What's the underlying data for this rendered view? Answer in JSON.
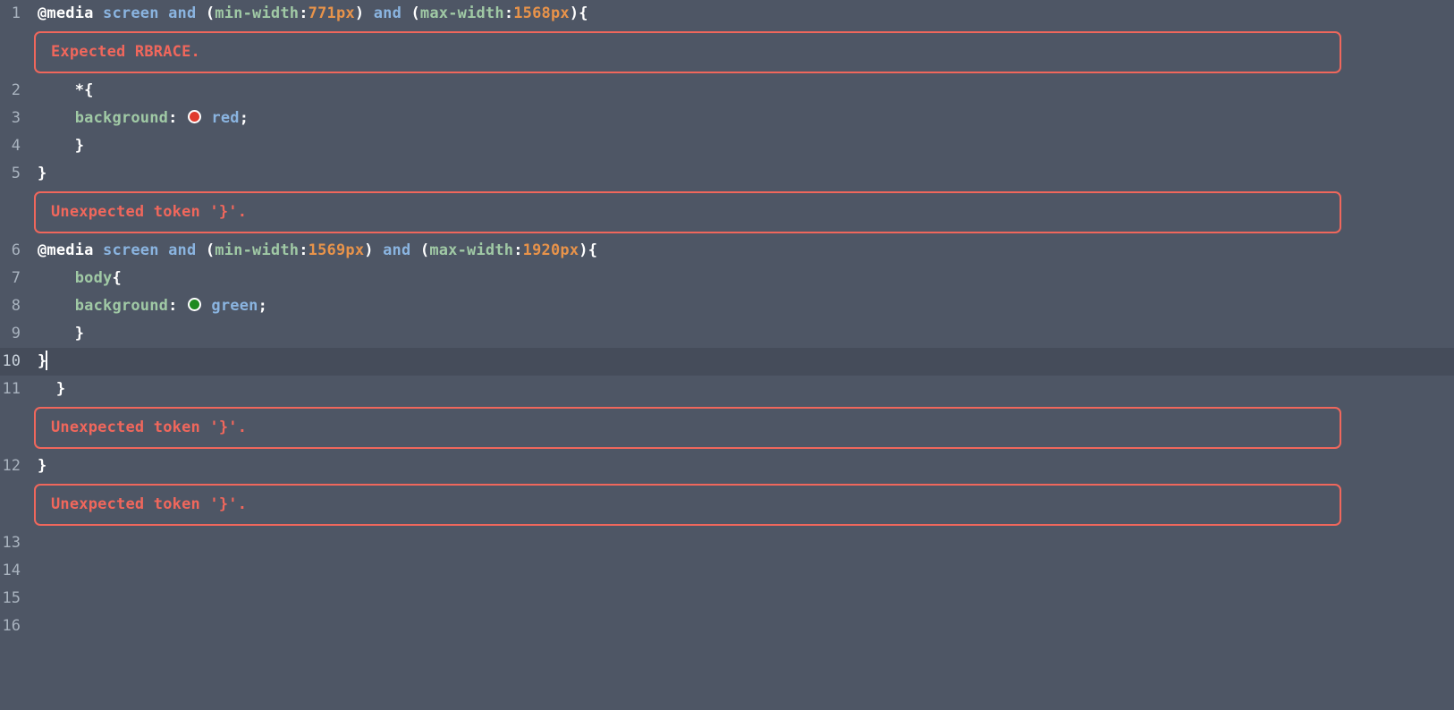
{
  "editor": {
    "theme": {
      "background": "#4e5665",
      "current_line_background": "#454c5a",
      "gutter_text": "#a9b3bf",
      "error_color": "#f0675c",
      "keyword": "#8ab4e0",
      "property": "#a0c9a5",
      "number": "#e8934a",
      "plain": "#ffffff"
    },
    "language": "css",
    "cursor_line": 10
  },
  "lines": [
    {
      "number": "1",
      "tokens": [
        {
          "name": "at-rule-keyword",
          "text": "@media",
          "cls": "t-at"
        },
        {
          "name": "space",
          "text": " ",
          "cls": "t-plain"
        },
        {
          "name": "media-type",
          "text": "screen",
          "cls": "t-kw"
        },
        {
          "name": "space",
          "text": " ",
          "cls": "t-plain"
        },
        {
          "name": "media-operator",
          "text": "and",
          "cls": "t-kw"
        },
        {
          "name": "punctuation",
          "text": " (",
          "cls": "t-plain"
        },
        {
          "name": "media-feature",
          "text": "min-width",
          "cls": "t-prop"
        },
        {
          "name": "punctuation",
          "text": ":",
          "cls": "t-plain"
        },
        {
          "name": "media-value",
          "text": "771px",
          "cls": "t-num"
        },
        {
          "name": "punctuation",
          "text": ") ",
          "cls": "t-plain"
        },
        {
          "name": "media-operator",
          "text": "and",
          "cls": "t-kw"
        },
        {
          "name": "punctuation",
          "text": " (",
          "cls": "t-plain"
        },
        {
          "name": "media-feature",
          "text": "max-width",
          "cls": "t-prop"
        },
        {
          "name": "punctuation",
          "text": ":",
          "cls": "t-plain"
        },
        {
          "name": "media-value",
          "text": "1568px",
          "cls": "t-num"
        },
        {
          "name": "punctuation",
          "text": "){",
          "cls": "t-plain"
        }
      ]
    },
    {
      "number": "2",
      "tokens": [
        {
          "name": "indent",
          "text": "    ",
          "cls": "t-plain"
        },
        {
          "name": "universal-selector",
          "text": "*{",
          "cls": "t-plain"
        }
      ]
    },
    {
      "number": "3",
      "tokens": [
        {
          "name": "indent",
          "text": "    ",
          "cls": "t-plain"
        },
        {
          "name": "property-name",
          "text": "background",
          "cls": "t-prop"
        },
        {
          "name": "punctuation",
          "text": ": ",
          "cls": "t-plain"
        },
        {
          "name": "color-swatch-red",
          "swatch": "#e03b2e"
        },
        {
          "name": "space",
          "text": " ",
          "cls": "t-plain"
        },
        {
          "name": "property-value",
          "text": "red",
          "cls": "t-val"
        },
        {
          "name": "punctuation",
          "text": ";",
          "cls": "t-plain"
        }
      ]
    },
    {
      "number": "4",
      "tokens": [
        {
          "name": "indent",
          "text": "    ",
          "cls": "t-plain"
        },
        {
          "name": "close-brace",
          "text": "}",
          "cls": "t-plain"
        }
      ]
    },
    {
      "number": "5",
      "tokens": [
        {
          "name": "close-brace",
          "text": "}",
          "cls": "t-plain"
        }
      ]
    },
    {
      "number": "6",
      "tokens": [
        {
          "name": "at-rule-keyword",
          "text": "@media",
          "cls": "t-at"
        },
        {
          "name": "space",
          "text": " ",
          "cls": "t-plain"
        },
        {
          "name": "media-type",
          "text": "screen",
          "cls": "t-kw"
        },
        {
          "name": "space",
          "text": " ",
          "cls": "t-plain"
        },
        {
          "name": "media-operator",
          "text": "and",
          "cls": "t-kw"
        },
        {
          "name": "punctuation",
          "text": " (",
          "cls": "t-plain"
        },
        {
          "name": "media-feature",
          "text": "min-width",
          "cls": "t-prop"
        },
        {
          "name": "punctuation",
          "text": ":",
          "cls": "t-plain"
        },
        {
          "name": "media-value",
          "text": "1569px",
          "cls": "t-num"
        },
        {
          "name": "punctuation",
          "text": ") ",
          "cls": "t-plain"
        },
        {
          "name": "media-operator",
          "text": "and",
          "cls": "t-kw"
        },
        {
          "name": "punctuation",
          "text": " (",
          "cls": "t-plain"
        },
        {
          "name": "media-feature",
          "text": "max-width",
          "cls": "t-prop"
        },
        {
          "name": "punctuation",
          "text": ":",
          "cls": "t-plain"
        },
        {
          "name": "media-value",
          "text": "1920px",
          "cls": "t-num"
        },
        {
          "name": "punctuation",
          "text": "){",
          "cls": "t-plain"
        }
      ]
    },
    {
      "number": "7",
      "tokens": [
        {
          "name": "indent",
          "text": "    ",
          "cls": "t-plain"
        },
        {
          "name": "element-selector",
          "text": "body",
          "cls": "t-sel"
        },
        {
          "name": "open-brace",
          "text": "{",
          "cls": "t-plain"
        }
      ]
    },
    {
      "number": "8",
      "tokens": [
        {
          "name": "indent",
          "text": "    ",
          "cls": "t-plain"
        },
        {
          "name": "property-name",
          "text": "background",
          "cls": "t-prop"
        },
        {
          "name": "punctuation",
          "text": ": ",
          "cls": "t-plain"
        },
        {
          "name": "color-swatch-green",
          "swatch": "#1e8a20"
        },
        {
          "name": "space",
          "text": " ",
          "cls": "t-plain"
        },
        {
          "name": "property-value",
          "text": "green",
          "cls": "t-val"
        },
        {
          "name": "punctuation",
          "text": ";",
          "cls": "t-plain"
        }
      ]
    },
    {
      "number": "9",
      "tokens": [
        {
          "name": "indent",
          "text": "    ",
          "cls": "t-plain"
        },
        {
          "name": "close-brace",
          "text": "}",
          "cls": "t-plain"
        }
      ]
    },
    {
      "number": "10",
      "current": true,
      "tokens": [
        {
          "name": "close-brace",
          "text": "}",
          "cls": "t-plain"
        },
        {
          "name": "text-cursor",
          "caret": true
        }
      ]
    },
    {
      "number": "11",
      "tokens": [
        {
          "name": "indent",
          "text": "  ",
          "cls": "t-plain"
        },
        {
          "name": "close-brace",
          "text": "}",
          "cls": "t-plain"
        }
      ]
    },
    {
      "number": "12",
      "tokens": [
        {
          "name": "close-brace",
          "text": "}",
          "cls": "t-plain"
        }
      ]
    },
    {
      "number": "13",
      "tokens": []
    },
    {
      "number": "14",
      "tokens": []
    },
    {
      "number": "15",
      "tokens": []
    },
    {
      "number": "16",
      "tokens": []
    }
  ],
  "errors": [
    {
      "id": "error-1",
      "after_line": "1",
      "message": "Expected RBRACE."
    },
    {
      "id": "error-2",
      "after_line": "5",
      "message": "Unexpected token '}'."
    },
    {
      "id": "error-3",
      "after_line": "11",
      "message": "Unexpected token '}'."
    },
    {
      "id": "error-4",
      "after_line": "12",
      "message": "Unexpected token '}'."
    }
  ]
}
